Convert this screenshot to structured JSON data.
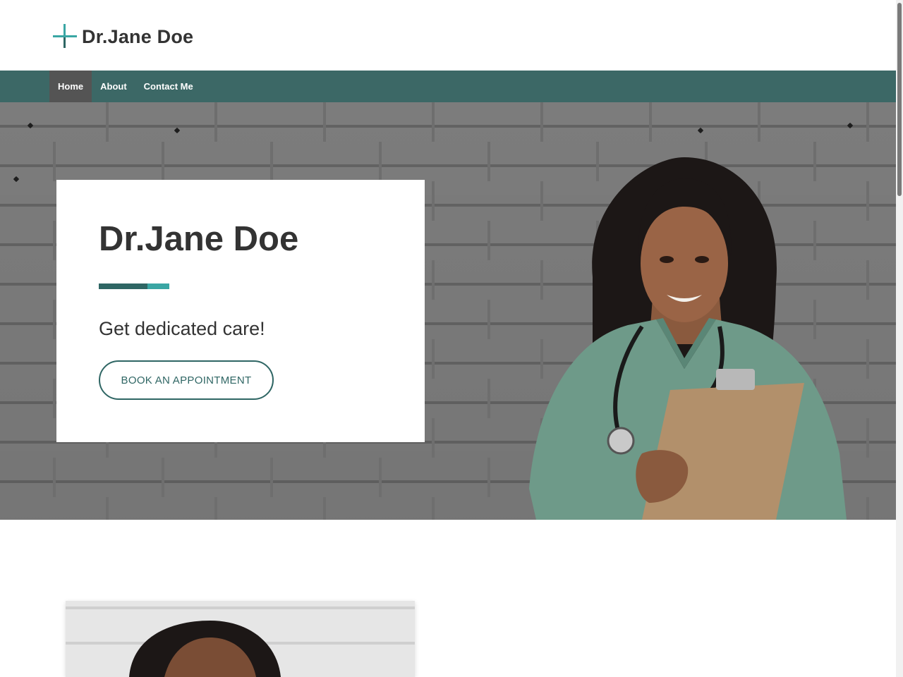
{
  "header": {
    "logo_icon": "medical-cross-icon",
    "site_name": "Dr.Jane Doe"
  },
  "nav": {
    "items": [
      {
        "label": "Home",
        "active": true
      },
      {
        "label": "About",
        "active": false
      },
      {
        "label": "Contact Me",
        "active": false
      }
    ]
  },
  "hero": {
    "title": "Dr.Jane Doe",
    "subtitle": "Get dedicated care!",
    "cta_label": "BOOK AN APPOINTMENT",
    "image": "doctor-portrait"
  },
  "about": {
    "image": "doctor-portrait"
  },
  "colors": {
    "nav_bg": "#3c6866",
    "nav_active_bg": "#545454",
    "accent_dark": "#2f6664",
    "accent_light": "#3aa6a4",
    "text": "#333333"
  }
}
